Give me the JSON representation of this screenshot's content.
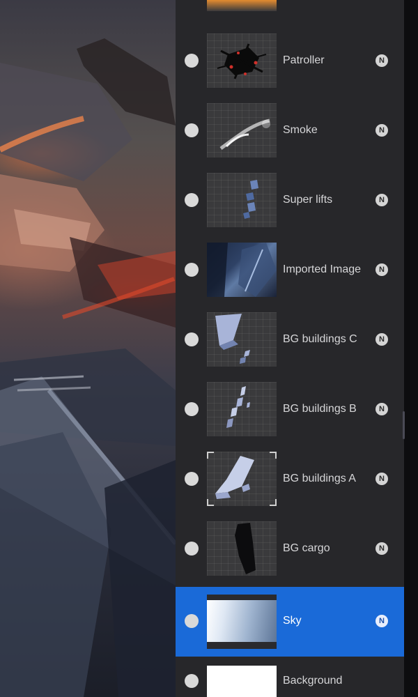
{
  "app": "Procreate",
  "layers_panel": {
    "layers": [
      {
        "name": "",
        "blend_mode": "",
        "visible": true,
        "selected": false,
        "partial": true
      },
      {
        "name": "Patroller",
        "blend_mode": "N",
        "visible": true,
        "selected": false
      },
      {
        "name": "Smoke",
        "blend_mode": "N",
        "visible": true,
        "selected": false
      },
      {
        "name": "Super lifts",
        "blend_mode": "N",
        "visible": true,
        "selected": false
      },
      {
        "name": "Imported Image",
        "blend_mode": "N",
        "visible": true,
        "selected": false
      },
      {
        "name": "BG buildings C",
        "blend_mode": "N",
        "visible": true,
        "selected": false
      },
      {
        "name": "BG buildings B",
        "blend_mode": "N",
        "visible": true,
        "selected": false
      },
      {
        "name": "BG buildings A",
        "blend_mode": "N",
        "visible": true,
        "selected": false
      },
      {
        "name": "BG cargo",
        "blend_mode": "N",
        "visible": true,
        "selected": false
      },
      {
        "name": "Sky",
        "blend_mode": "N",
        "visible": true,
        "selected": true
      },
      {
        "name": "Background",
        "blend_mode": "",
        "visible": true,
        "selected": false
      }
    ]
  },
  "colors": {
    "panel_bg": "#27272a",
    "selected_bg": "#1a6ad8",
    "text": "#d6d6d8"
  }
}
